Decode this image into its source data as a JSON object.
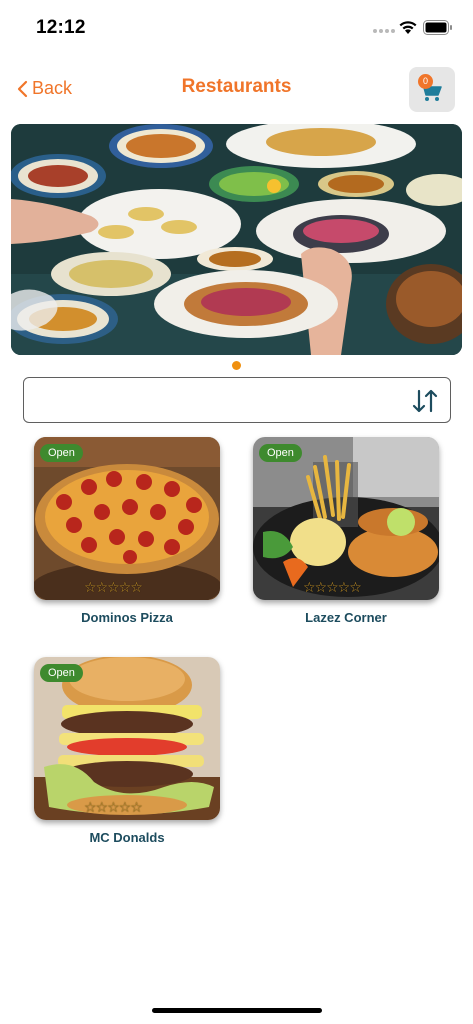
{
  "status": {
    "time": "12:12"
  },
  "nav": {
    "back_label": "Back",
    "title": "Restaurants",
    "cart_count": "0"
  },
  "banner": {
    "pages": 1,
    "active_page": 1
  },
  "sort": {
    "value": "",
    "placeholder": ""
  },
  "restaurants": [
    {
      "name": "Dominos Pizza",
      "status": "Open",
      "rating_stars": "☆☆☆☆☆"
    },
    {
      "name": "Lazez Corner",
      "status": "Open",
      "rating_stars": "☆☆☆☆☆"
    },
    {
      "name": "MC Donalds",
      "status": "Open",
      "rating_stars": "☆☆☆☆☆"
    }
  ],
  "colors": {
    "accent": "#f0752a",
    "open_badge": "#3e8a2e",
    "card_title": "#1d4c5e"
  }
}
